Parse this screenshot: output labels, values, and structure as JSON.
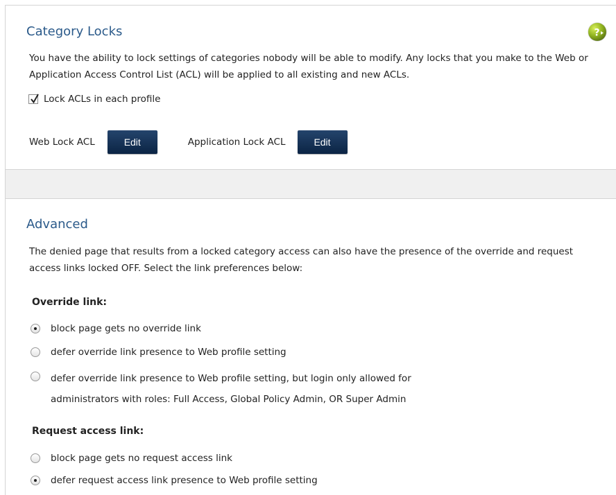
{
  "category_locks": {
    "title": "Category Locks",
    "description": "You have the ability to lock settings of categories nobody will be able to modify. Any locks that you make to the Web or Application Access Control List (ACL) will be applied to all existing and new ACLs.",
    "lock_checkbox_label": "Lock ACLs in each profile",
    "lock_checked": true,
    "web_lock_label": "Web Lock ACL",
    "web_edit_label": "Edit",
    "app_lock_label": "Application Lock ACL",
    "app_edit_label": "Edit"
  },
  "advanced": {
    "title": "Advanced",
    "description": "The denied page that results from a locked category access can also have the presence of the override and request access links locked OFF. Select the link preferences below:",
    "override": {
      "heading": "Override link:",
      "options": [
        {
          "label": "block page gets no override link",
          "selected": true
        },
        {
          "label": "defer override link presence to Web profile setting",
          "selected": false
        },
        {
          "label": "defer override link presence to Web profile setting, but login only allowed for",
          "label_line2": "administrators with roles: Full Access, Global Policy Admin, OR Super Admin",
          "selected": false
        }
      ]
    },
    "request_access": {
      "heading": "Request access link:",
      "options": [
        {
          "label": "block page gets no request access link",
          "selected": false
        },
        {
          "label": "defer request access link presence to Web profile setting",
          "selected": true
        }
      ]
    }
  },
  "icons": {
    "help": "help-icon",
    "checkmark": "checkmark-icon"
  },
  "colors": {
    "heading": "#2b5a8a",
    "button": "#0b2444",
    "gap": "#f0f0f0"
  }
}
